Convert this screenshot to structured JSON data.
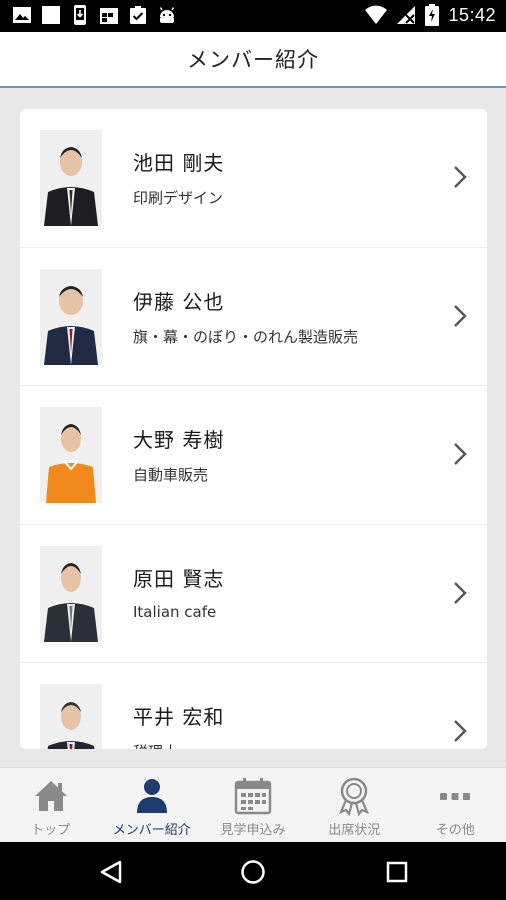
{
  "status_bar": {
    "time": "15:42",
    "icons_left": [
      "image-icon",
      "blank-square-icon",
      "phone-download-icon",
      "calendar-icon",
      "clipboard-check-icon",
      "android-icon"
    ],
    "icons_right": [
      "wifi-icon",
      "no-signal-icon",
      "battery-charging-icon"
    ]
  },
  "app_bar": {
    "title": "メンバー紹介"
  },
  "members": [
    {
      "name": "池田 剛夫",
      "job": "印刷デザイン",
      "shirt": "#1e1e22",
      "tie": "#2c2c2c"
    },
    {
      "name": "伊藤 公也",
      "job": "旗・幕・のぼり・のれん製造販売",
      "shirt": "#1f2a44",
      "tie": "#8b1e2a"
    },
    {
      "name": "大野 寿樹",
      "job": "自動車販売",
      "shirt": "#f08a1c",
      "tie": "#f08a1c"
    },
    {
      "name": "原田 賢志",
      "job": "Italian cafe",
      "shirt": "#2a2f38",
      "tie": "#6a7686"
    },
    {
      "name": "平井 宏和",
      "job": "税理士",
      "shirt": "#23262e",
      "tie": "#7a1a2a"
    }
  ],
  "bottom_nav": [
    {
      "label": "トップ",
      "icon": "home-icon",
      "active": false
    },
    {
      "label": "メンバー紹介",
      "icon": "person-icon",
      "active": true
    },
    {
      "label": "見学申込み",
      "icon": "calendar-icon",
      "active": false
    },
    {
      "label": "出席状況",
      "icon": "award-badge-icon",
      "active": false
    },
    {
      "label": "その他",
      "icon": "more-dots-icon",
      "active": false
    }
  ],
  "colors": {
    "active_nav": "#1f3a6d",
    "inactive_nav": "#8a8a8a",
    "background": "#e8e8e8",
    "appbar_border": "#7b8ea6"
  }
}
